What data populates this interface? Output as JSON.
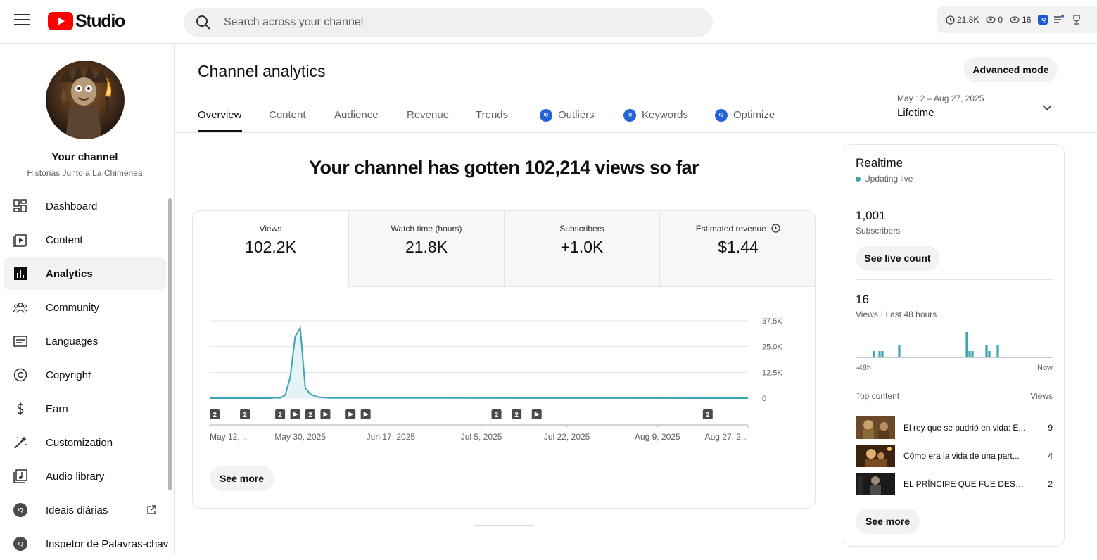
{
  "header": {
    "logo_text": "Studio",
    "search_placeholder": "Search across your channel",
    "ext_stats": [
      {
        "icon": "clock-icon",
        "value": "21.8K"
      },
      {
        "icon": "eye-icon",
        "value": "0"
      },
      {
        "icon": "eye-icon",
        "value": "16"
      }
    ]
  },
  "sidebar": {
    "channel_title": "Your channel",
    "channel_name": "Historias Junto a La Chimenea",
    "items": [
      {
        "label": "Dashboard",
        "icon": "dashboard-icon"
      },
      {
        "label": "Content",
        "icon": "content-icon"
      },
      {
        "label": "Analytics",
        "icon": "analytics-icon",
        "active": true
      },
      {
        "label": "Community",
        "icon": "community-icon"
      },
      {
        "label": "Languages",
        "icon": "languages-icon"
      },
      {
        "label": "Copyright",
        "icon": "copyright-icon"
      },
      {
        "label": "Earn",
        "icon": "earn-icon"
      },
      {
        "label": "Customization",
        "icon": "customization-icon"
      },
      {
        "label": "Audio library",
        "icon": "audio-library-icon"
      },
      {
        "label": "Ideais diárias",
        "icon": "iq-icon",
        "external": true
      },
      {
        "label": "Inspetor de Palavras-chav",
        "icon": "iq-icon"
      }
    ]
  },
  "main": {
    "title": "Channel analytics",
    "advanced_label": "Advanced mode",
    "tabs": [
      {
        "label": "Overview",
        "active": true
      },
      {
        "label": "Content"
      },
      {
        "label": "Audience"
      },
      {
        "label": "Revenue"
      },
      {
        "label": "Trends"
      },
      {
        "label": "Outliers",
        "badge": true
      },
      {
        "label": "Keywords",
        "badge": true
      },
      {
        "label": "Optimize",
        "badge": true
      }
    ],
    "date_range": "May 12 – Aug 27, 2025",
    "period": "Lifetime",
    "headline": "Your channel has gotten 102,214 views so far",
    "metrics": [
      {
        "label": "Views",
        "value": "102.2K"
      },
      {
        "label": "Watch time (hours)",
        "value": "21.8K"
      },
      {
        "label": "Subscribers",
        "value": "+1.0K"
      },
      {
        "label": "Estimated revenue",
        "value": "$1.44"
      }
    ],
    "see_more": "See more"
  },
  "chart_data": {
    "type": "area",
    "y_ticks": [
      "37.5K",
      "25.0K",
      "12.5K",
      "0"
    ],
    "ylim": [
      0,
      37500
    ],
    "x_labels": [
      "May 12, ...",
      "May 30, 2025",
      "Jun 17, 2025",
      "Jul 5, 2025",
      "Jul 22, 2025",
      "Aug 9, 2025",
      "Aug 27, 2..."
    ],
    "x_label_days": [
      0,
      18,
      36,
      54,
      71,
      89,
      107
    ],
    "series": [
      {
        "values": [
          [
            0,
            0
          ],
          [
            12,
            0
          ],
          [
            13,
            200
          ],
          [
            14,
            100
          ],
          [
            15,
            1500
          ],
          [
            16,
            10000
          ],
          [
            17,
            30000
          ],
          [
            18,
            34000
          ],
          [
            19,
            5000
          ],
          [
            20,
            2000
          ],
          [
            21,
            900
          ],
          [
            22,
            400
          ],
          [
            23,
            200
          ],
          [
            24,
            100
          ],
          [
            107,
            0
          ]
        ]
      }
    ],
    "markers": [
      {
        "day": 1,
        "type": "number",
        "label": "2"
      },
      {
        "day": 7,
        "type": "number",
        "label": "2"
      },
      {
        "day": 14,
        "type": "number",
        "label": "2"
      },
      {
        "day": 17,
        "type": "play"
      },
      {
        "day": 20,
        "type": "number",
        "label": "2"
      },
      {
        "day": 23,
        "type": "play"
      },
      {
        "day": 28,
        "type": "play"
      },
      {
        "day": 31,
        "type": "play"
      },
      {
        "day": 57,
        "type": "number",
        "label": "2"
      },
      {
        "day": 61,
        "type": "number",
        "label": "2"
      },
      {
        "day": 65,
        "type": "play"
      },
      {
        "day": 99,
        "type": "number",
        "label": "2"
      }
    ]
  },
  "realtime": {
    "title": "Realtime",
    "status": "Updating live",
    "subs_value": "1,001",
    "subs_label": "Subscribers",
    "live_count_label": "See live count",
    "views_value": "16",
    "views_label": "Views · Last 48 hours",
    "axis_start": "-48h",
    "axis_end": "Now",
    "bars_48h": [
      0,
      0,
      0,
      0,
      0,
      0,
      1,
      0,
      1,
      1,
      0,
      0,
      0,
      0,
      0,
      2,
      0,
      0,
      0,
      0,
      0,
      0,
      0,
      0,
      0,
      0,
      0,
      0,
      0,
      0,
      0,
      0,
      0,
      0,
      0,
      0,
      0,
      0,
      0,
      4,
      1,
      1,
      0,
      0,
      0,
      0,
      2,
      1,
      0,
      0,
      2,
      0,
      0,
      0,
      0,
      0,
      0,
      0,
      0,
      0,
      0,
      0,
      0,
      0,
      0,
      0,
      0,
      0,
      0,
      0
    ],
    "top_content_label": "Top content",
    "top_views_label": "Views",
    "top_items": [
      {
        "title": "El rey que se pudrió en vida: E...",
        "views": "9"
      },
      {
        "title": "Cómo era la vida de una part...",
        "views": "4"
      },
      {
        "title": "EL PRÍNCIPE QUE FUE DESOL...",
        "views": "2"
      }
    ],
    "see_more": "See more"
  },
  "colors": {
    "accent_line": "#3ba3b3",
    "accent_fill": "#e3f3f6",
    "live_dot": "#3ba3b3",
    "iq_badge": "#2563d9",
    "yt_red": "#ff0000"
  }
}
